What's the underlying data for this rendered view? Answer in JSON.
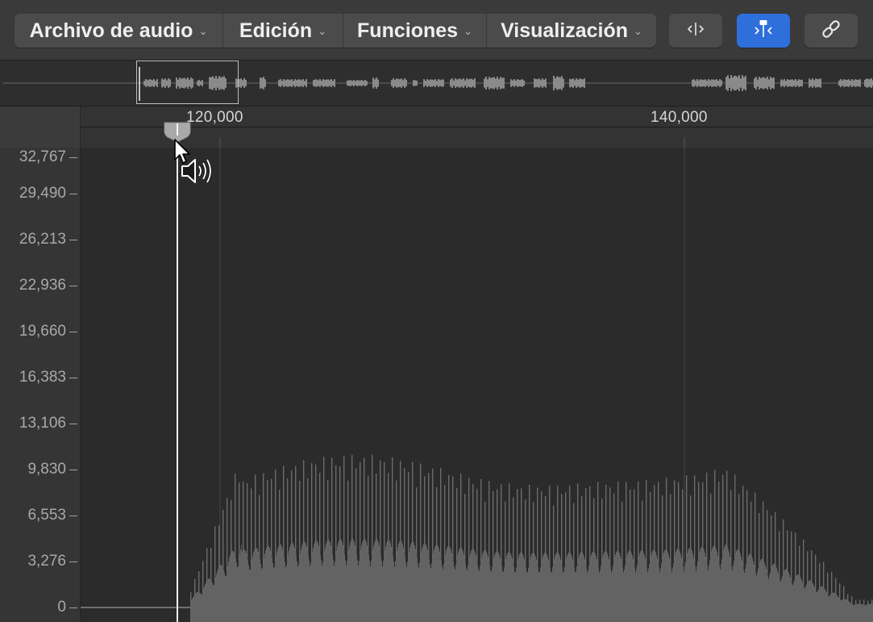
{
  "toolbar": {
    "menus": [
      {
        "label": "Archivo de audio"
      },
      {
        "label": "Edición"
      },
      {
        "label": "Funciones"
      },
      {
        "label": "Visualización"
      }
    ],
    "active_color": "#2f6fdc",
    "buttons": [
      {
        "name": "link-button",
        "icon": "link-icon"
      },
      {
        "name": "catch-button",
        "icon": "catch-icon"
      },
      {
        "name": "split-view-button",
        "icon": "split-arrows-icon"
      }
    ]
  },
  "ruler": {
    "labels": [
      "120,000",
      "140,000"
    ]
  },
  "y_axis": {
    "labels": [
      "32,767",
      "29,490",
      "26,213",
      "22,936",
      "19,660",
      "16,383",
      "13,106",
      "9,830",
      "6,553",
      "3,276",
      "0"
    ]
  },
  "playhead": {
    "tooltip_icon": "speaker-scrub-icon"
  }
}
